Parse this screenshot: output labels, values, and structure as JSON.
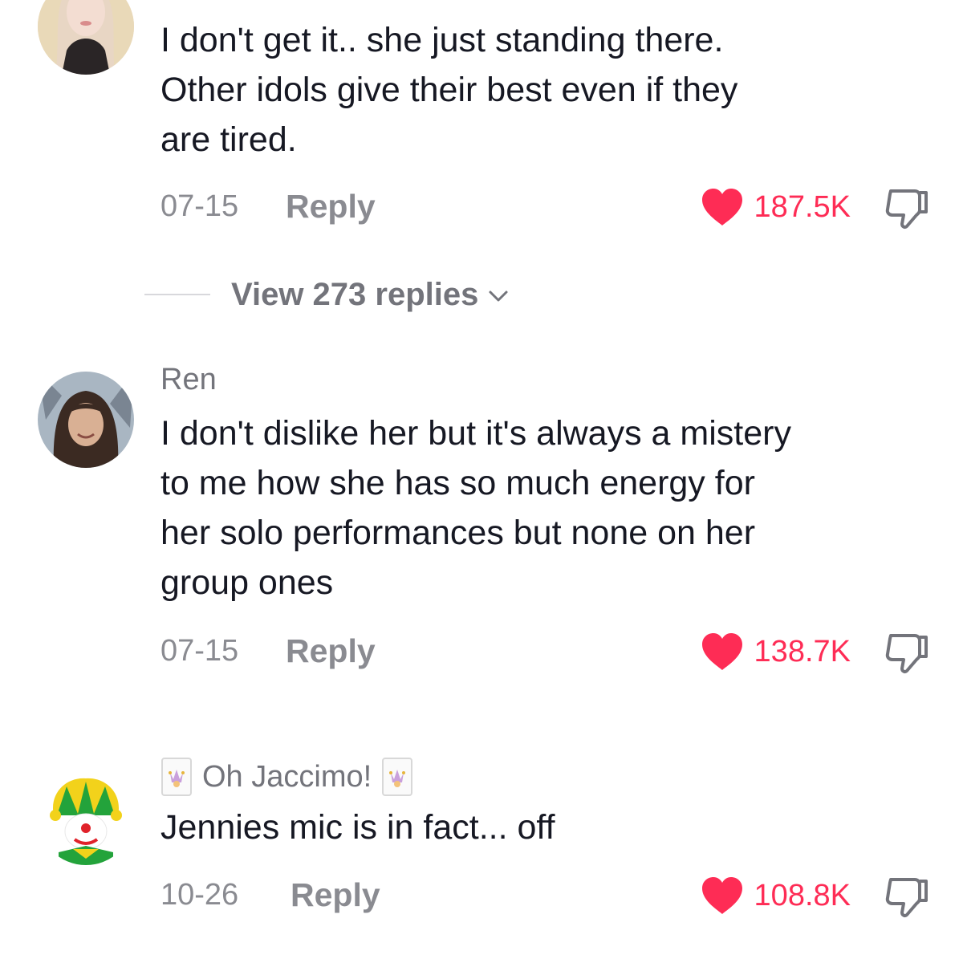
{
  "comments": [
    {
      "username": "",
      "text_lines": [
        "I don't get it.. she just standing there.",
        "Other idols give their best even if they",
        "are tired."
      ],
      "date": "07-15",
      "reply_label": "Reply",
      "likes": "187.5K",
      "view_replies": "View 273 replies"
    },
    {
      "username": "Ren",
      "text_lines": [
        "I don't dislike her but it's always a mistery",
        "to me how she has so much energy for",
        "her solo performances but none on her",
        "group ones"
      ],
      "date": "07-15",
      "reply_label": "Reply",
      "likes": "138.7K"
    },
    {
      "username": "Oh Jaccimo!",
      "text_lines": [
        "Jennies mic is in fact... off"
      ],
      "date": "10-26",
      "reply_label": "Reply",
      "likes": "108.8K"
    }
  ],
  "icons": {
    "like": "heart-icon",
    "dislike": "thumbs-down-icon",
    "expand": "chevron-down-icon",
    "username_badge": "jester-card-icon"
  },
  "colors": {
    "like_red": "#fe2c55",
    "meta_gray": "#8a8b91",
    "text_dark": "#161823"
  }
}
